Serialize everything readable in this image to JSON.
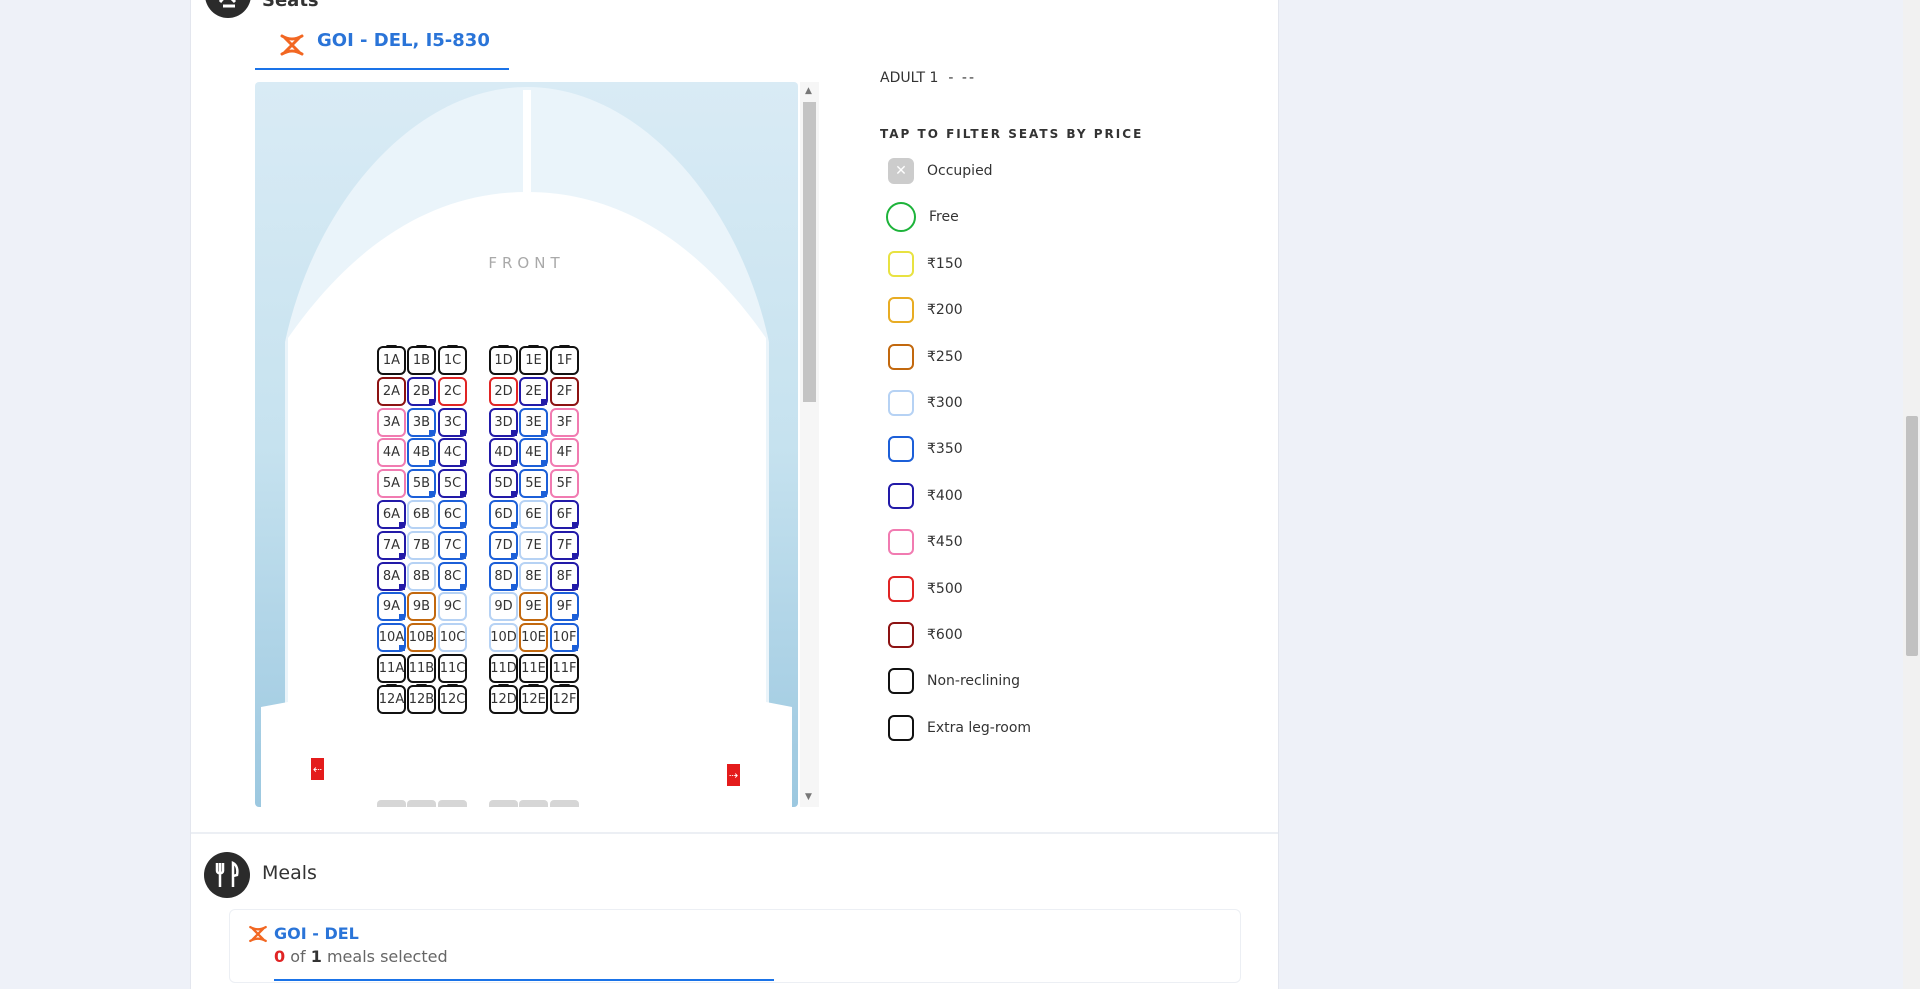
{
  "seats_section": {
    "title": "Seats",
    "flight_tab": "GOI - DEL, I5-830",
    "front_label": "FRONT",
    "adult_label": "ADULT 1",
    "adult_seat": "- --",
    "filter_title": "TAP TO FILTER SEATS BY PRICE"
  },
  "seat_map": {
    "columns": [
      "A",
      "B",
      "C",
      "D",
      "E",
      "F"
    ],
    "rows": [
      {
        "row": "1",
        "types": [
          "legroom",
          "legroom",
          "legroom",
          "legroom",
          "legroom",
          "legroom"
        ]
      },
      {
        "row": "2",
        "types": [
          "p600",
          "p400",
          "p500",
          "p500",
          "p400",
          "p600"
        ]
      },
      {
        "row": "3",
        "types": [
          "p450",
          "p350",
          "p400",
          "p400",
          "p350",
          "p450"
        ]
      },
      {
        "row": "4",
        "types": [
          "p450",
          "p350",
          "p400",
          "p400",
          "p350",
          "p450"
        ]
      },
      {
        "row": "5",
        "types": [
          "p450",
          "p350",
          "p400",
          "p400",
          "p350",
          "p450"
        ]
      },
      {
        "row": "6",
        "types": [
          "p400",
          "p300",
          "p350",
          "p350",
          "p300",
          "p400"
        ]
      },
      {
        "row": "7",
        "types": [
          "p400",
          "p300",
          "p350",
          "p350",
          "p300",
          "p400"
        ]
      },
      {
        "row": "8",
        "types": [
          "p400",
          "p300",
          "p350",
          "p350",
          "p300",
          "p400"
        ]
      },
      {
        "row": "9",
        "types": [
          "p350",
          "p250",
          "p300",
          "p300",
          "p250",
          "p350"
        ]
      },
      {
        "row": "10",
        "types": [
          "p350",
          "p250",
          "p300",
          "p300",
          "p250",
          "p350"
        ]
      },
      {
        "row": "11",
        "types": [
          "nonrec",
          "nonrec",
          "nonrec",
          "nonrec",
          "nonrec",
          "nonrec"
        ]
      },
      {
        "row": "12",
        "types": [
          "legroom",
          "legroom",
          "legroom",
          "legroom",
          "legroom",
          "legroom"
        ]
      }
    ]
  },
  "legend": [
    {
      "label": "Occupied",
      "type": "occupied",
      "color": "#cccccc"
    },
    {
      "label": "Free",
      "type": "free",
      "color": "#1db33a"
    },
    {
      "label": "₹150",
      "type": "p150",
      "color": "#e8e241"
    },
    {
      "label": "₹200",
      "type": "p200",
      "color": "#e8ac23"
    },
    {
      "label": "₹250",
      "type": "p250",
      "color": "#c2680e"
    },
    {
      "label": "₹300",
      "type": "p300",
      "color": "#b6d2f4"
    },
    {
      "label": "₹350",
      "type": "p350",
      "color": "#1c5fd8"
    },
    {
      "label": "₹400",
      "type": "p400",
      "color": "#221aa8"
    },
    {
      "label": "₹450",
      "type": "p450",
      "color": "#f17bb1"
    },
    {
      "label": "₹500",
      "type": "p500",
      "color": "#e02424"
    },
    {
      "label": "₹600",
      "type": "p600",
      "color": "#8c1212"
    },
    {
      "label": "Non-reclining",
      "type": "nonrec",
      "color": "#111111"
    },
    {
      "label": "Extra leg-room",
      "type": "legroom",
      "color": "#111111"
    }
  ],
  "meals_section": {
    "title": "Meals",
    "route": "GOI - DEL",
    "selected_count": "0",
    "of_text": " of ",
    "total": "1",
    "suffix": " meals selected"
  },
  "colors": {
    "accent": "#2a74d8",
    "brand_orange": "#f26722",
    "exit_red": "#e41b1b"
  }
}
